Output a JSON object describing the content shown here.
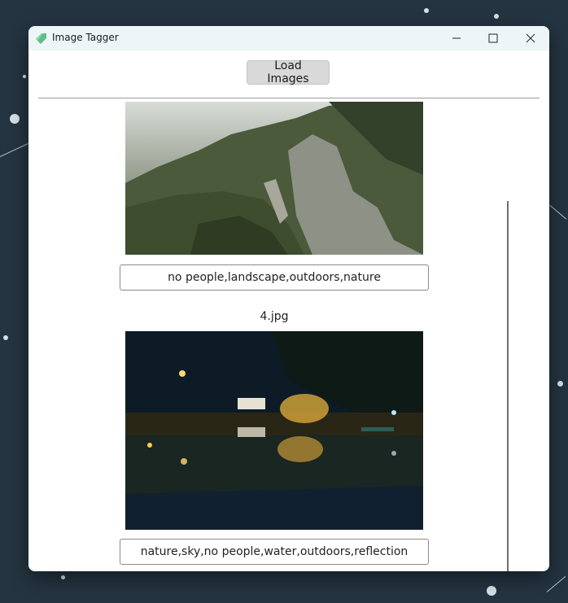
{
  "window": {
    "title": "Image Tagger",
    "icon": "tag-icon",
    "controls": [
      "minimize-icon",
      "maximize-icon",
      "close-icon"
    ]
  },
  "toolbar": {
    "load_label": "Load Images"
  },
  "images": [
    {
      "filename": "",
      "tags": "no people,landscape,outdoors,nature"
    },
    {
      "filename": "4.jpg",
      "tags": "nature,sky,no people,water,outdoors,reflection"
    }
  ],
  "colors": {
    "accent_icon": "#5bbf86",
    "desktop": "#243440",
    "button": "#d9d9d9"
  }
}
